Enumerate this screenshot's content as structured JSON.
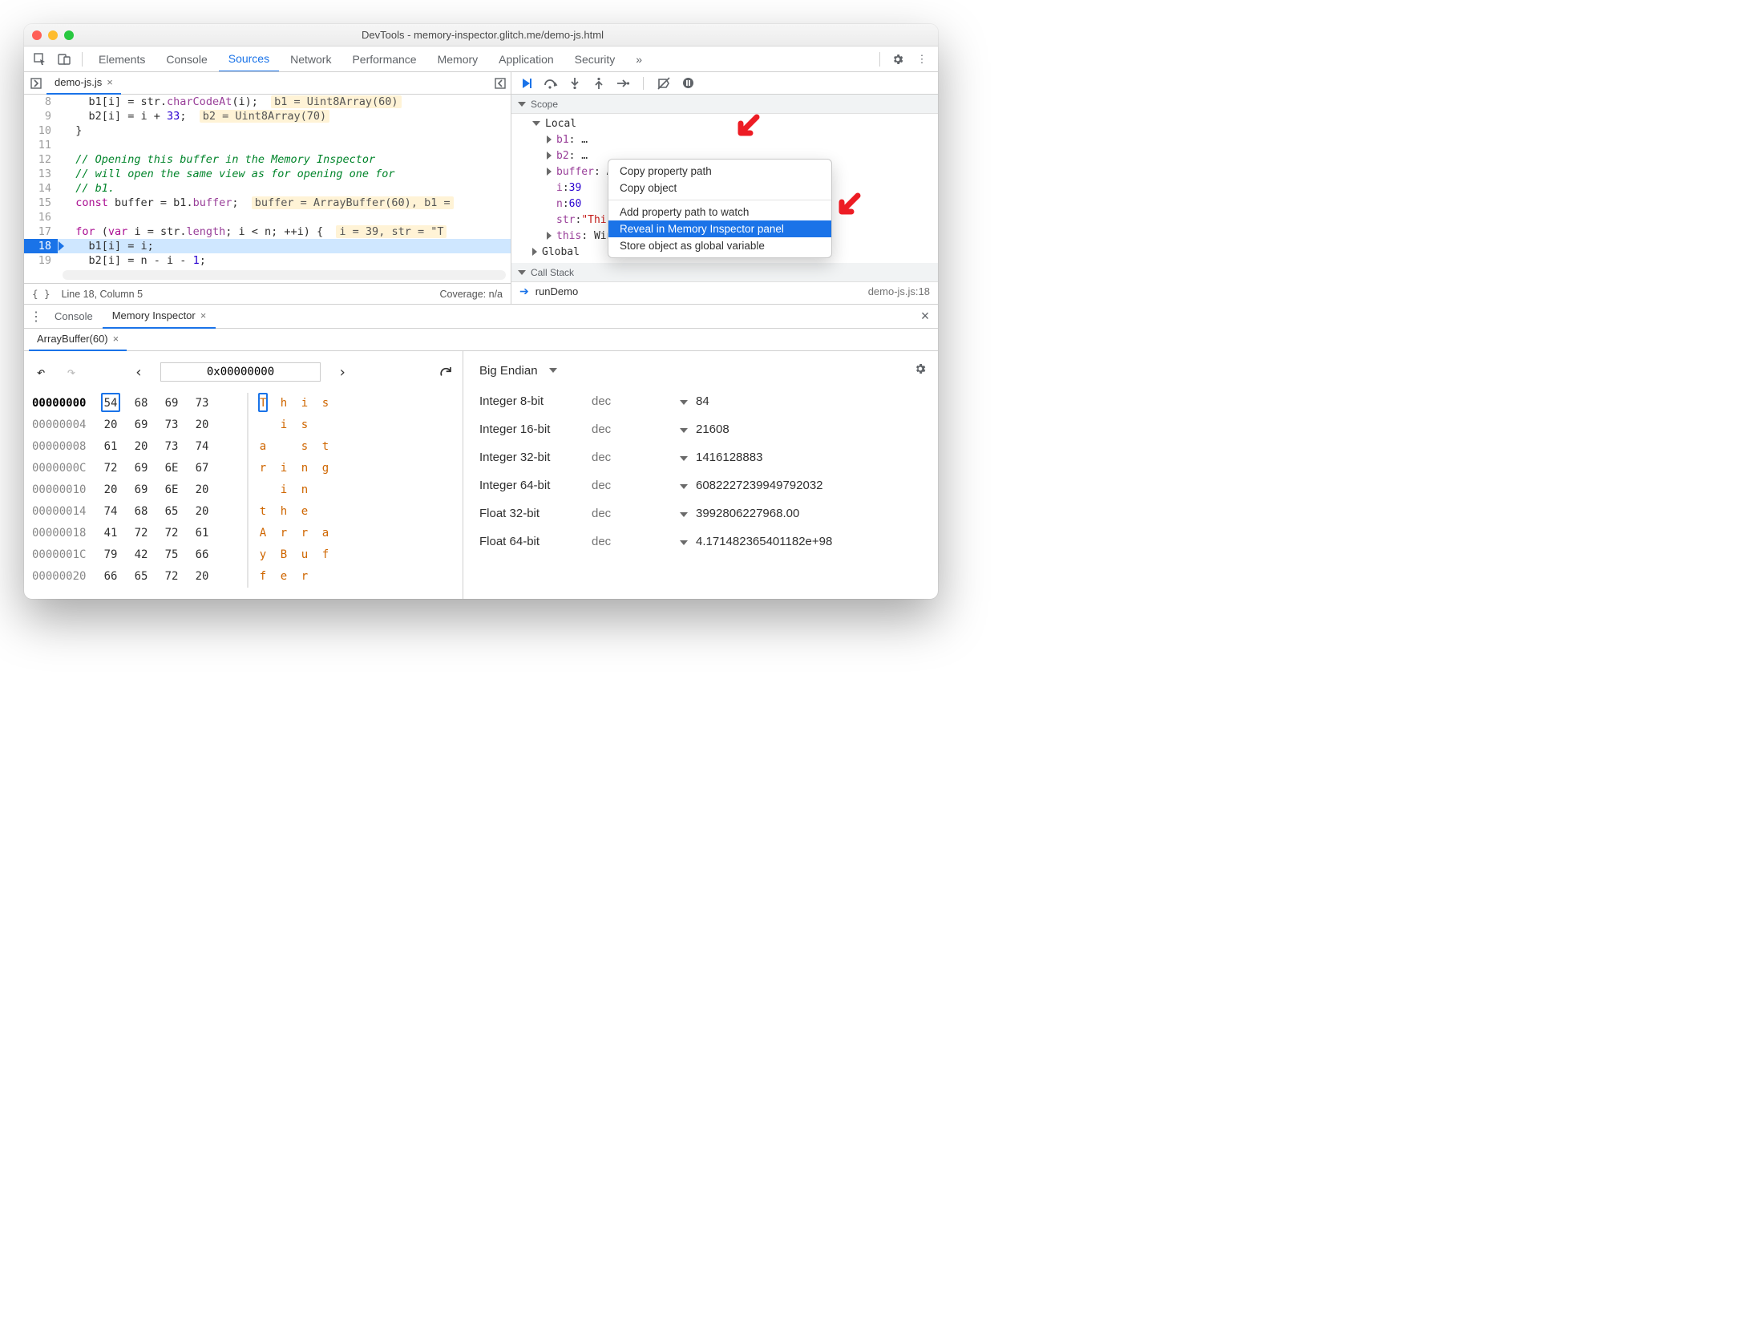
{
  "window": {
    "title": "DevTools - memory-inspector.glitch.me/demo-js.html"
  },
  "main_tabs": [
    "Elements",
    "Console",
    "Sources",
    "Network",
    "Performance",
    "Memory",
    "Application",
    "Security"
  ],
  "main_tab_active": 2,
  "file_tab": {
    "name": "demo-js.js"
  },
  "code": {
    "line_start": 8,
    "execution_line": 18,
    "lines": [
      {
        "raw": "    b1[i] = str.charCodeAt(i);",
        "eval": "b1 = Uint8Array(60)"
      },
      {
        "raw": "    b2[i] = i + 33;",
        "eval": "b2 = Uint8Array(70)"
      },
      {
        "raw": "  }"
      },
      {
        "raw": ""
      },
      {
        "raw": "  // Opening this buffer in the Memory Inspector",
        "comment": true
      },
      {
        "raw": "  // will open the same view as for opening one for",
        "comment": true
      },
      {
        "raw": "  // b1.",
        "comment": true
      },
      {
        "raw": "  const buffer = b1.buffer;",
        "const": true,
        "eval": "buffer = ArrayBuffer(60), b1 ="
      },
      {
        "raw": ""
      },
      {
        "raw": "  for (var i = str.length; i < n; ++i) {",
        "for": true,
        "eval": "i = 39, str = \"T"
      },
      {
        "raw": "    b1[i] = i;"
      },
      {
        "raw": "    b2[i] = n - i - 1;"
      },
      {
        "raw": "  }"
      },
      {
        "raw": ""
      }
    ]
  },
  "status": {
    "cursor": "Line 18, Column 5",
    "coverage": "Coverage: n/a"
  },
  "scope": {
    "section": "Scope",
    "local_label": "Local",
    "rows": [
      {
        "name": "b1",
        "suffix": ": …",
        "expand": true
      },
      {
        "name": "b2",
        "suffix": ": …",
        "expand": true
      },
      {
        "name": "buffer",
        "suffix": ": ArrayBuffer(60)",
        "expand": true,
        "chip": true
      },
      {
        "name": "i",
        "num": "39"
      },
      {
        "name": "n",
        "num": "60"
      },
      {
        "name": "str",
        "str": "\"This                :)!\""
      },
      {
        "name": "this",
        "suffix": ": Window",
        "expand": true,
        "trail": "indow"
      }
    ],
    "global_label": "Global",
    "callstack_label": "Call Stack",
    "callstack": {
      "fn": "runDemo",
      "file": "demo-js.js:18"
    }
  },
  "context_menu": {
    "items": [
      "Copy property path",
      "Copy object",
      "Add property path to watch",
      "Reveal in Memory Inspector panel",
      "Store object as global variable"
    ],
    "selected_index": 3,
    "divider_after": 1
  },
  "drawer": {
    "tabs": [
      "Console",
      "Memory Inspector"
    ],
    "active": 1
  },
  "memory_inspector": {
    "buffer_tab": "ArrayBuffer(60)",
    "address": "0x00000000",
    "hex_rows": [
      {
        "addr": "00000000",
        "b": [
          "54",
          "68",
          "69",
          "73"
        ],
        "a": [
          "T",
          "h",
          "i",
          "s"
        ],
        "sel": 0,
        "first": true
      },
      {
        "addr": "00000004",
        "b": [
          "20",
          "69",
          "73",
          "20"
        ],
        "a": [
          " ",
          "i",
          "s",
          " "
        ]
      },
      {
        "addr": "00000008",
        "b": [
          "61",
          "20",
          "73",
          "74"
        ],
        "a": [
          "a",
          " ",
          "s",
          "t"
        ]
      },
      {
        "addr": "0000000C",
        "b": [
          "72",
          "69",
          "6E",
          "67"
        ],
        "a": [
          "r",
          "i",
          "n",
          "g"
        ]
      },
      {
        "addr": "00000010",
        "b": [
          "20",
          "69",
          "6E",
          "20"
        ],
        "a": [
          " ",
          "i",
          "n",
          " "
        ]
      },
      {
        "addr": "00000014",
        "b": [
          "74",
          "68",
          "65",
          "20"
        ],
        "a": [
          "t",
          "h",
          "e",
          " "
        ]
      },
      {
        "addr": "00000018",
        "b": [
          "41",
          "72",
          "72",
          "61"
        ],
        "a": [
          "A",
          "r",
          "r",
          "a"
        ]
      },
      {
        "addr": "0000001C",
        "b": [
          "79",
          "42",
          "75",
          "66"
        ],
        "a": [
          "y",
          "B",
          "u",
          "f"
        ]
      },
      {
        "addr": "00000020",
        "b": [
          "66",
          "65",
          "72",
          "20"
        ],
        "a": [
          "f",
          "e",
          "r",
          " "
        ]
      }
    ],
    "endian": "Big Endian",
    "values": [
      {
        "label": "Integer 8-bit",
        "mode": "dec",
        "val": "84"
      },
      {
        "label": "Integer 16-bit",
        "mode": "dec",
        "val": "21608"
      },
      {
        "label": "Integer 32-bit",
        "mode": "dec",
        "val": "1416128883"
      },
      {
        "label": "Integer 64-bit",
        "mode": "dec",
        "val": "6082227239949792032"
      },
      {
        "label": "Float 32-bit",
        "mode": "dec",
        "val": "3992806227968.00"
      },
      {
        "label": "Float 64-bit",
        "mode": "dec",
        "val": "4.171482365401182e+98"
      }
    ]
  }
}
